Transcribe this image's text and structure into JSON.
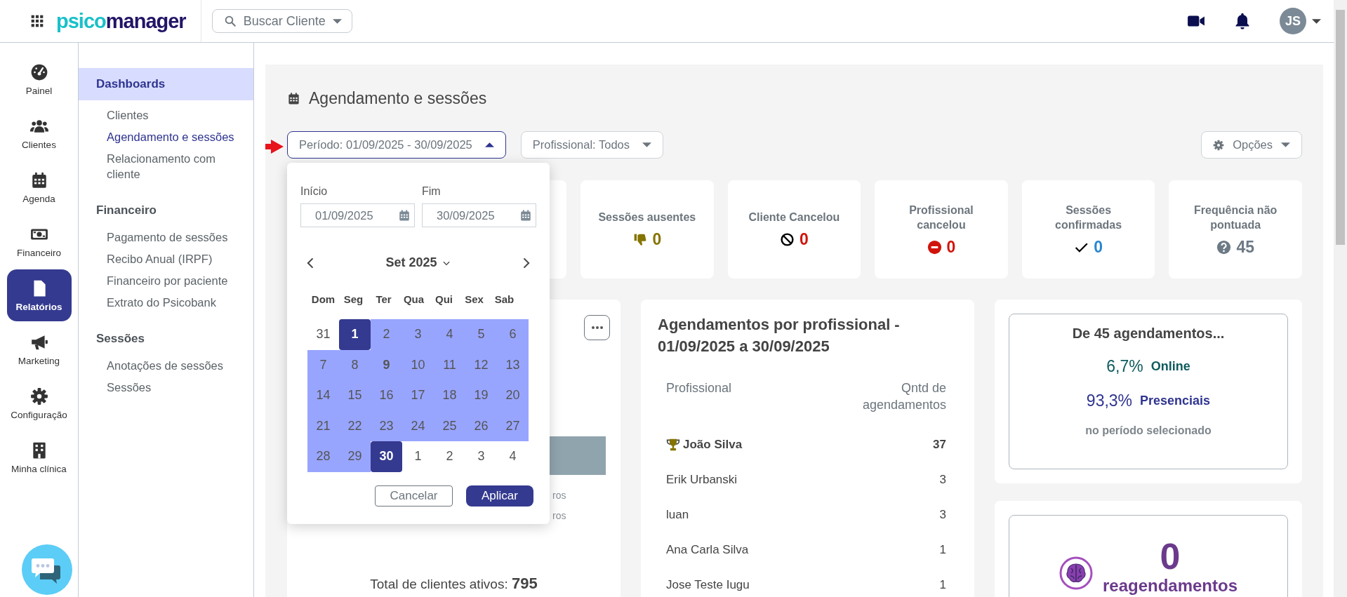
{
  "topbar": {
    "logo": [
      "psico",
      "manager"
    ],
    "search": {
      "label": "Buscar Cliente"
    },
    "avatar": "JS"
  },
  "rail": {
    "items": [
      {
        "label": "Painel",
        "selected": false
      },
      {
        "label": "Clientes",
        "selected": false
      },
      {
        "label": "Agenda",
        "selected": false
      },
      {
        "label": "Financeiro",
        "selected": false
      },
      {
        "label": "Relatórios",
        "selected": true
      },
      {
        "label": "Marketing",
        "selected": false
      },
      {
        "label": "Configuração",
        "selected": false
      },
      {
        "label": "Minha clínica",
        "selected": false
      }
    ]
  },
  "submenu": {
    "sections": [
      {
        "title": "Dashboards",
        "selected": true,
        "items": [
          {
            "label": "Clientes",
            "selected": false
          },
          {
            "label": "Agendamento e sessões",
            "selected": true
          },
          {
            "label": "Relacionamento com cliente",
            "selected": false
          }
        ]
      },
      {
        "title": "Financeiro",
        "selected": false,
        "items": [
          {
            "label": "Pagamento de sessões",
            "selected": false
          },
          {
            "label": "Recibo Anual (IRPF)",
            "selected": false
          },
          {
            "label": "Financeiro por paciente",
            "selected": false
          },
          {
            "label": "Extrato do Psicobank",
            "selected": false
          }
        ]
      },
      {
        "title": "Sessões",
        "selected": false,
        "items": [
          {
            "label": "Anotações de sessões",
            "selected": false
          },
          {
            "label": "Sessões",
            "selected": false
          }
        ]
      }
    ]
  },
  "page_title": "Agendamento e sessões",
  "filters": [
    {
      "label": "Período: 01/09/2025 - 30/09/2025",
      "expanded": true
    },
    {
      "label": "Profissional: Todos",
      "expanded": false
    }
  ],
  "options": "Opções",
  "stats": [
    {
      "label": "Sessões ausentes",
      "value": "0",
      "kind": "thumbs-down",
      "color": "#857400"
    },
    {
      "label": "Cliente Cancelou",
      "value": "0",
      "kind": "ban",
      "color": "#d0140c"
    },
    {
      "label": "Profissional cancelou",
      "value": "0",
      "kind": "minus",
      "color": "#d0140c"
    },
    {
      "label": "Sessões confirmadas",
      "value": "0",
      "kind": "check",
      "color": "#2a87d0"
    },
    {
      "label": "Frequência não pontuada",
      "value": "45",
      "kind": "question",
      "color": "#6c7a86"
    }
  ],
  "datepicker": {
    "start_label": "Início",
    "start": "01/09/2025",
    "end_label": "Fim",
    "end": "30/09/2025",
    "month": "Set 2025",
    "weekdays": [
      "Dom",
      "Seg",
      "Ter",
      "Qua",
      "Qui",
      "Sex",
      "Sab"
    ],
    "days": [
      {
        "label": "31",
        "in_range": false,
        "selected": false,
        "today": false
      },
      {
        "label": "1",
        "in_range": true,
        "selected": true,
        "today": false
      },
      {
        "label": "2",
        "in_range": true,
        "selected": false,
        "today": false
      },
      {
        "label": "3",
        "in_range": true,
        "selected": false,
        "today": false
      },
      {
        "label": "4",
        "in_range": true,
        "selected": false,
        "today": false
      },
      {
        "label": "5",
        "in_range": true,
        "selected": false,
        "today": false
      },
      {
        "label": "6",
        "in_range": true,
        "selected": false,
        "today": false
      },
      {
        "label": "7",
        "in_range": true,
        "selected": false,
        "today": false
      },
      {
        "label": "8",
        "in_range": true,
        "selected": false,
        "today": false
      },
      {
        "label": "9",
        "in_range": true,
        "selected": false,
        "today": true
      },
      {
        "label": "10",
        "in_range": true,
        "selected": false,
        "today": false
      },
      {
        "label": "11",
        "in_range": true,
        "selected": false,
        "today": false
      },
      {
        "label": "12",
        "in_range": true,
        "selected": false,
        "today": false
      },
      {
        "label": "13",
        "in_range": true,
        "selected": false,
        "today": false
      },
      {
        "label": "14",
        "in_range": true,
        "selected": false,
        "today": false
      },
      {
        "label": "15",
        "in_range": true,
        "selected": false,
        "today": false
      },
      {
        "label": "16",
        "in_range": true,
        "selected": false,
        "today": false
      },
      {
        "label": "17",
        "in_range": true,
        "selected": false,
        "today": false
      },
      {
        "label": "18",
        "in_range": true,
        "selected": false,
        "today": false
      },
      {
        "label": "19",
        "in_range": true,
        "selected": false,
        "today": false
      },
      {
        "label": "20",
        "in_range": true,
        "selected": false,
        "today": false
      },
      {
        "label": "21",
        "in_range": true,
        "selected": false,
        "today": false
      },
      {
        "label": "22",
        "in_range": true,
        "selected": false,
        "today": false
      },
      {
        "label": "23",
        "in_range": true,
        "selected": false,
        "today": false
      },
      {
        "label": "24",
        "in_range": true,
        "selected": false,
        "today": false
      },
      {
        "label": "25",
        "in_range": true,
        "selected": false,
        "today": false
      },
      {
        "label": "26",
        "in_range": true,
        "selected": false,
        "today": false
      },
      {
        "label": "27",
        "in_range": true,
        "selected": false,
        "today": false
      },
      {
        "label": "28",
        "in_range": true,
        "selected": false,
        "today": false
      },
      {
        "label": "29",
        "in_range": true,
        "selected": false,
        "today": false
      },
      {
        "label": "30",
        "in_range": true,
        "selected": true,
        "today": false
      },
      {
        "label": "1",
        "in_range": false,
        "selected": false,
        "today": false
      },
      {
        "label": "2",
        "in_range": false,
        "selected": false,
        "today": false
      },
      {
        "label": "3",
        "in_range": false,
        "selected": false,
        "today": false
      },
      {
        "label": "4",
        "in_range": false,
        "selected": false,
        "today": false
      }
    ],
    "buttons": [
      "Cancelar",
      "Aplicar"
    ]
  },
  "clients_card": {
    "legend": [
      "ros",
      "ros"
    ],
    "total_label": "Total de clientes ativos:",
    "total_value": "795"
  },
  "professionals": {
    "title": "Agendamentos por profissional - 01/09/2025 a 30/09/2025",
    "columns": [
      "Profissional",
      "Qntd de agendamentos"
    ],
    "rows": [
      {
        "name": "João Silva",
        "count": "37",
        "top": true
      },
      {
        "name": "Erik Urbanski",
        "count": "3",
        "top": false
      },
      {
        "name": "luan",
        "count": "3",
        "top": false
      },
      {
        "name": "Ana Carla Silva",
        "count": "1",
        "top": false
      },
      {
        "name": "Jose Teste Iugu",
        "count": "1",
        "top": false
      }
    ]
  },
  "summary": {
    "title": "De 45 agendamentos...",
    "lines": [
      {
        "percent": "6,7%",
        "label": "Online",
        "color": "#0d5a5e"
      },
      {
        "percent": "93,3%",
        "label": "Presenciais",
        "color": "#2f3490"
      }
    ],
    "note": "no período selecionado"
  },
  "reschedules": {
    "value": "0",
    "label": "reagendamentos"
  }
}
